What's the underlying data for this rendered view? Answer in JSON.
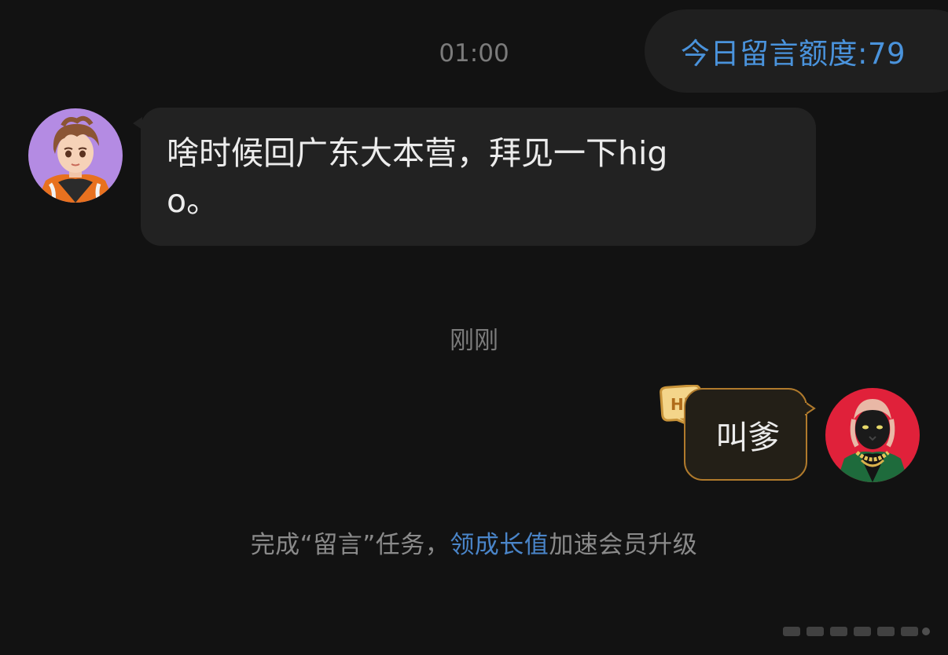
{
  "header": {
    "quota_label": "今日留言额度:79"
  },
  "conversation": {
    "timestamps": [
      "01:00",
      "刚刚"
    ],
    "incoming_message": {
      "text": "啥时候回广东大本营，拜见一下higo。"
    },
    "outgoing_message": {
      "text": "叫爹",
      "badge": "Hi"
    }
  },
  "footer": {
    "prefix": "完成“留言”任务，",
    "link": "领成长值",
    "suffix": "加速会员升级"
  },
  "colors": {
    "background": "#121212",
    "accent_blue": "#4a93dc",
    "bubble_gold_border": "#b07a2c",
    "incoming_bubble": "#222222"
  },
  "icons": {
    "left_avatar": "anime-boy-avatar",
    "right_avatar": "panther-avatar",
    "badge": "hi-speech-badge"
  }
}
